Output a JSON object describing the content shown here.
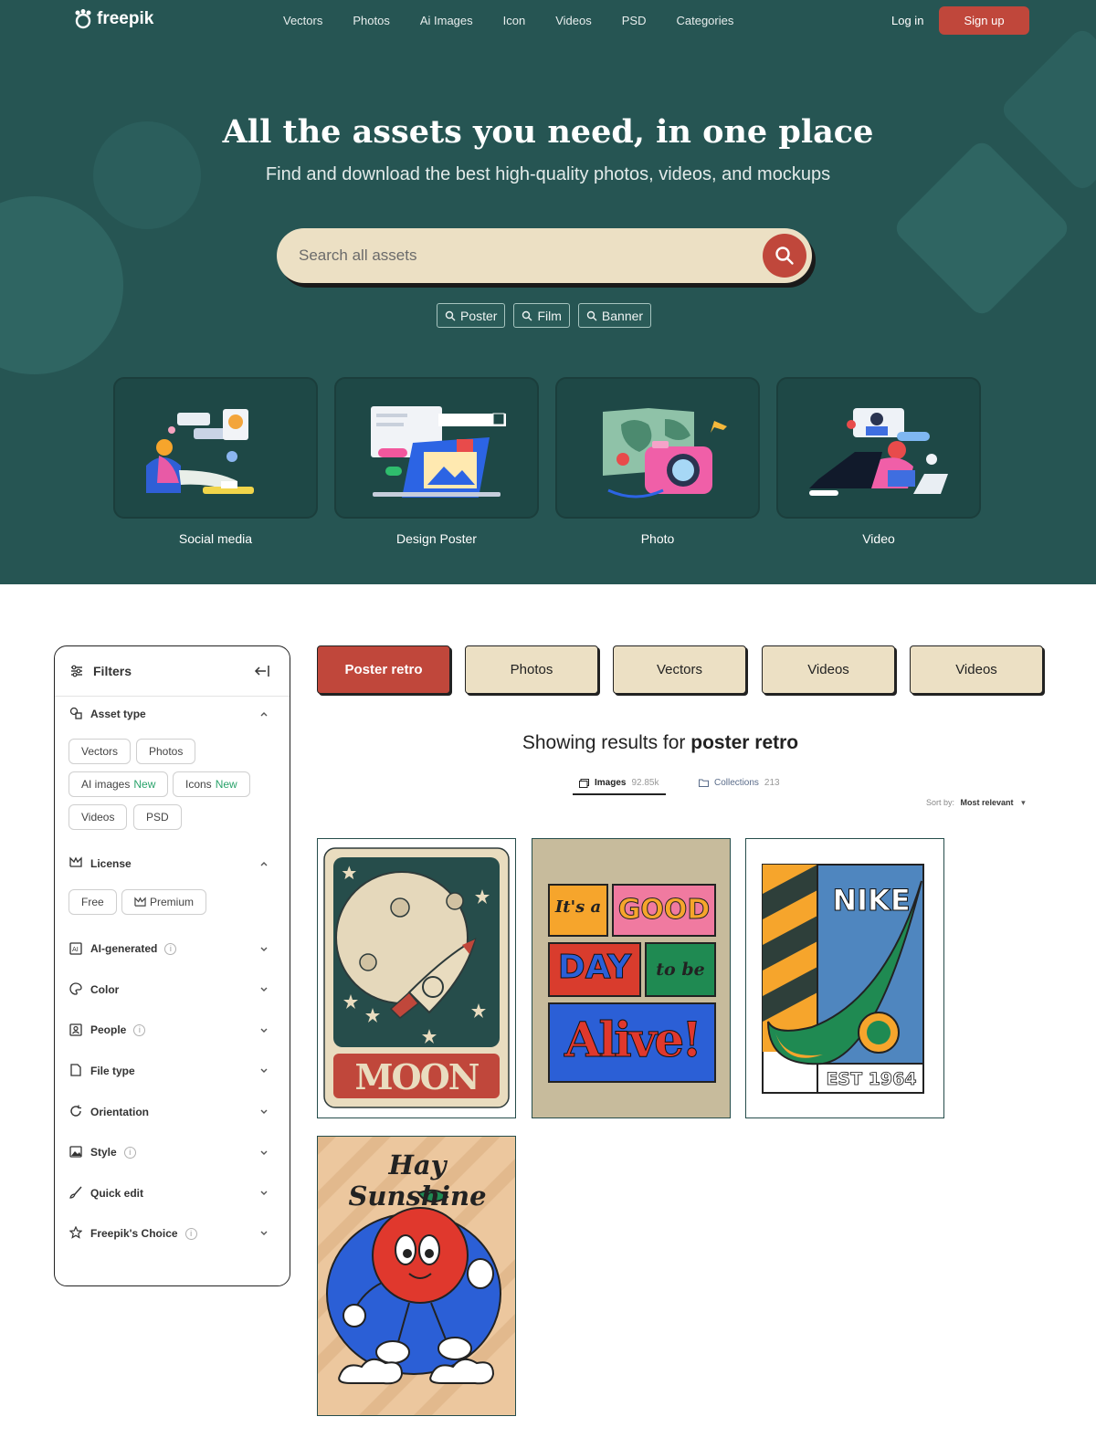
{
  "brand": {
    "name": "freepik"
  },
  "nav": {
    "links": [
      "Vectors",
      "Photos",
      "Ai Images",
      "Icon",
      "Videos",
      "PSD",
      "Categories"
    ],
    "login": "Log in",
    "signup": "Sign up"
  },
  "hero": {
    "title": "All the assets you need, in one place",
    "subtitle": "Find and download the best high-quality photos, videos, and mockups",
    "search_placeholder": "Search all assets",
    "suggestions": [
      "Poster",
      "Film",
      "Banner"
    ],
    "categories": [
      "Social media",
      "Design Poster",
      "Photo",
      "Video"
    ]
  },
  "filters": {
    "title": "Filters",
    "asset_type": {
      "label": "Asset type",
      "options": [
        "Vectors",
        "Photos",
        "AI images",
        "Icons",
        "Videos",
        "PSD"
      ],
      "new_badge": "New"
    },
    "license": {
      "label": "License",
      "options": [
        "Free",
        "Premium"
      ]
    },
    "sections": [
      "AI-generated",
      "Color",
      "People",
      "File type",
      "Orientation",
      "Style",
      "Quick edit",
      "Freepik's Choice"
    ]
  },
  "tabs": [
    "Poster retro",
    "Photos",
    "Vectors",
    "Videos",
    "Videos"
  ],
  "results": {
    "prefix": "Showing results for",
    "query": "poster retro",
    "images_label": "Images",
    "images_count": "92.85k",
    "collections_label": "Collections",
    "collections_count": "213",
    "sort_label": "Sort by:",
    "sort_value": "Most relevant"
  },
  "posters": {
    "moon": "MOON",
    "good1": "It's a",
    "good2": "GOOD",
    "good3": "DAY",
    "good4": "to be",
    "good5": "Alive!",
    "nike": "NIKE",
    "est": "EST 1964",
    "sunshine": "Hay Sunshine"
  },
  "colors": {
    "hero_bg": "#265553",
    "accent": "#c0473b",
    "cream": "#ece0c4"
  }
}
